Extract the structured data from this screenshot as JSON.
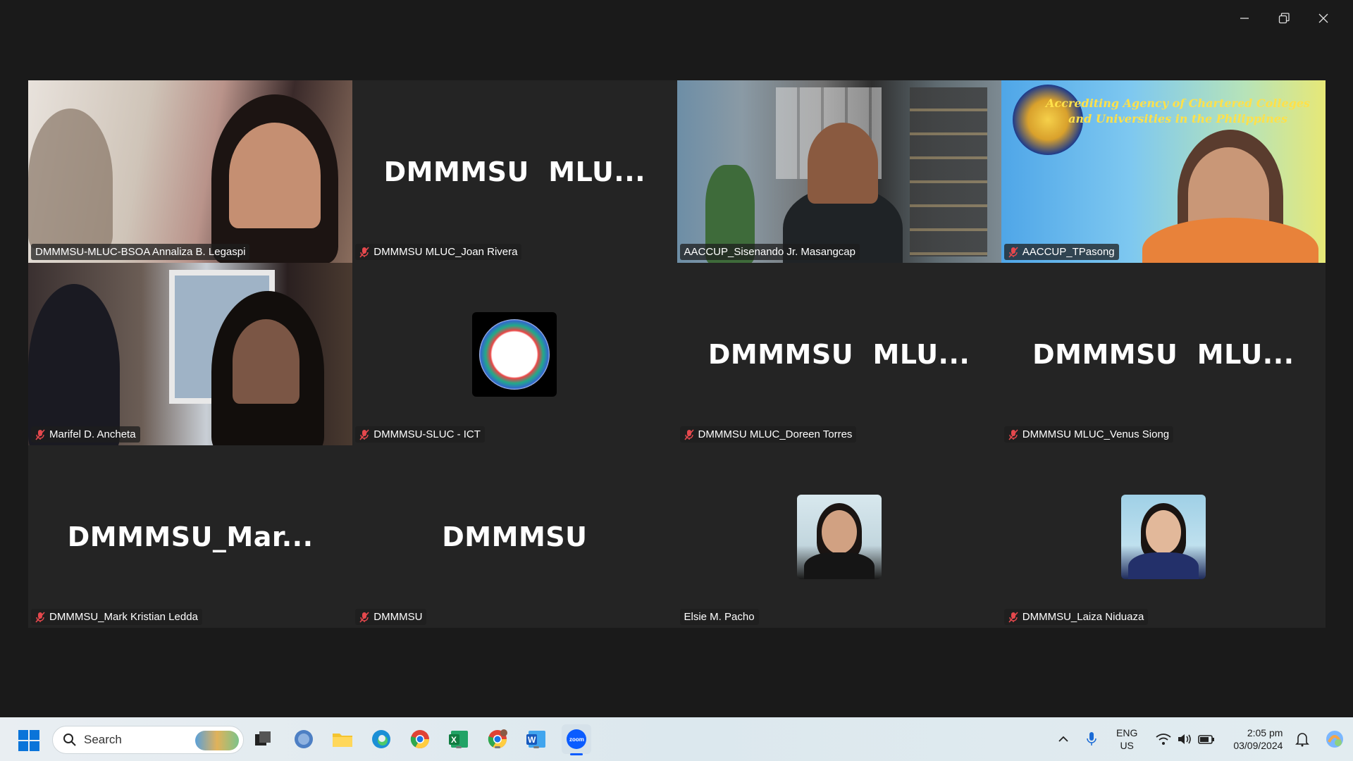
{
  "window": {
    "controls": [
      "minimize",
      "restore",
      "close"
    ]
  },
  "tiles": [
    {
      "name": "DMMMSU-MLUC-BSOA Annaliza B. Legaspi",
      "kind": "video",
      "muted": false
    },
    {
      "name": "DMMMSU MLUC_Joan Rivera",
      "kind": "text",
      "display": "DMMMSU  MLU...",
      "muted": true
    },
    {
      "name": "AACCUP_Sisenando Jr. Masangcap",
      "kind": "video",
      "muted": false,
      "active": true
    },
    {
      "name": "AACCUP_TPasong",
      "kind": "video",
      "muted": true,
      "banner_line1": "Accrediting Agency of Chartered Colleges",
      "banner_line2": "and Universities in the Philippines"
    },
    {
      "name": "Marifel D. Ancheta",
      "kind": "video",
      "muted": true
    },
    {
      "name": "DMMMSU-SLUC - ICT",
      "kind": "avatar",
      "muted": true
    },
    {
      "name": "DMMMSU MLUC_Doreen Torres",
      "kind": "text",
      "display": "DMMMSU  MLU...",
      "muted": true
    },
    {
      "name": "DMMMSU MLUC_Venus Siong",
      "kind": "text",
      "display": "DMMMSU  MLU...",
      "muted": true
    },
    {
      "name": "DMMMSU_Mark Kristian Ledda",
      "kind": "text",
      "display": "DMMMSU_Mar...",
      "muted": true
    },
    {
      "name": "DMMMSU",
      "kind": "text",
      "display": "DMMMSU",
      "muted": true
    },
    {
      "name": "Elsie M. Pacho",
      "kind": "avatar",
      "muted": false
    },
    {
      "name": "DMMMSU_Laiza Niduaza",
      "kind": "avatar",
      "muted": true
    }
  ],
  "taskbar": {
    "search_placeholder": "Search",
    "language": "ENG",
    "region": "US",
    "time": "2:05 pm",
    "date": "03/09/2024"
  },
  "colors": {
    "active_speaker": "#2ed45c",
    "muted_icon": "#e5484d"
  }
}
